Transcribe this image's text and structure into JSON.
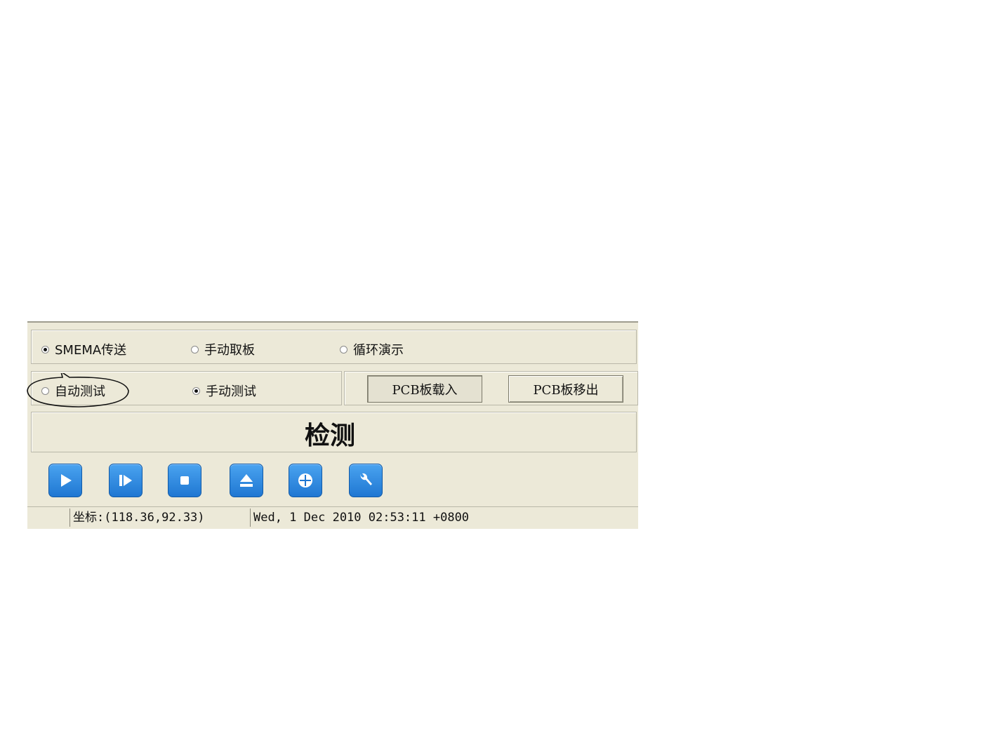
{
  "transfer_mode": {
    "options": [
      "SMEMA传送",
      "手动取板",
      "循环演示"
    ],
    "selected": "SMEMA传送"
  },
  "test_mode": {
    "options": [
      "自动测试",
      "手动测试"
    ],
    "selected": "手动测试"
  },
  "pcb_buttons": {
    "load": "PCB板载入",
    "unload": "PCB板移出"
  },
  "main_title": "检测",
  "toolbar": {
    "icons": [
      "play-icon",
      "step-icon",
      "stop-icon",
      "eject-icon",
      "crosshair-icon",
      "wrench-icon"
    ],
    "accent": "#1f77d2"
  },
  "status_bar": {
    "coordinates": "坐标:(118.36,92.33)",
    "datetime": "Wed, 1 Dec 2010 02:53:11 +0800"
  }
}
